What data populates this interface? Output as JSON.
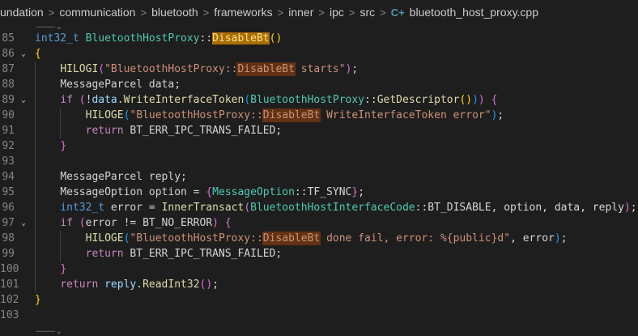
{
  "breadcrumb": {
    "items": [
      "undation",
      "communication",
      "bluetooth",
      "frameworks",
      "inner",
      "ipc",
      "src"
    ],
    "separator": ">",
    "file_icon": "C+",
    "file_name": "bluetooth_host_proxy.cpp"
  },
  "lines": [
    {
      "n": "85",
      "tokens": [
        {
          "t": "int32_t",
          "c": "kw"
        },
        {
          "t": " ",
          "c": "pl"
        },
        {
          "t": "BluetoothHostProxy",
          "c": "ty"
        },
        {
          "t": "::",
          "c": "pl"
        },
        {
          "t": "DisableBt",
          "c": "fn hl-sel"
        },
        {
          "t": "()",
          "c": "br1"
        }
      ]
    },
    {
      "n": "86",
      "fold": "v",
      "tokens": [
        {
          "t": "{",
          "c": "br1"
        }
      ]
    },
    {
      "n": "87",
      "guide": [
        1
      ],
      "tokens": [
        {
          "t": "    ",
          "c": "pl"
        },
        {
          "t": "HILOGI",
          "c": "fn"
        },
        {
          "t": "(",
          "c": "br2"
        },
        {
          "t": "\"BluetoothHostProxy::",
          "c": "str"
        },
        {
          "t": "DisableBt",
          "c": "str hl"
        },
        {
          "t": " starts\"",
          "c": "str"
        },
        {
          "t": ")",
          "c": "br2"
        },
        {
          "t": ";",
          "c": "pl"
        }
      ]
    },
    {
      "n": "88",
      "guide": [
        1
      ],
      "tokens": [
        {
          "t": "    ",
          "c": "pl"
        },
        {
          "t": "MessageParcel",
          "c": "pl"
        },
        {
          "t": " data;",
          "c": "pl"
        }
      ]
    },
    {
      "n": "89",
      "fold": "v",
      "guide": [
        1
      ],
      "tokens": [
        {
          "t": "    ",
          "c": "pl"
        },
        {
          "t": "if",
          "c": "kw2"
        },
        {
          "t": " ",
          "c": "pl"
        },
        {
          "t": "(",
          "c": "br2"
        },
        {
          "t": "!",
          "c": "pl"
        },
        {
          "t": "data",
          "c": "var"
        },
        {
          "t": ".",
          "c": "pl"
        },
        {
          "t": "WriteInterfaceToken",
          "c": "fn"
        },
        {
          "t": "(",
          "c": "br3"
        },
        {
          "t": "BluetoothHostProxy",
          "c": "ty"
        },
        {
          "t": "::",
          "c": "pl"
        },
        {
          "t": "GetDescriptor",
          "c": "fn"
        },
        {
          "t": "()",
          "c": "br1"
        },
        {
          "t": ")",
          "c": "br3"
        },
        {
          "t": ")",
          "c": "br2"
        },
        {
          "t": " ",
          "c": "pl"
        },
        {
          "t": "{",
          "c": "br2"
        }
      ]
    },
    {
      "n": "90",
      "guide": [
        1,
        2
      ],
      "tokens": [
        {
          "t": "        ",
          "c": "pl"
        },
        {
          "t": "HILOGE",
          "c": "fn"
        },
        {
          "t": "(",
          "c": "br3"
        },
        {
          "t": "\"BluetoothHostProxy::",
          "c": "str"
        },
        {
          "t": "DisableBt",
          "c": "str hl"
        },
        {
          "t": " WriteInterfaceToken error\"",
          "c": "str"
        },
        {
          "t": ")",
          "c": "br3"
        },
        {
          "t": ";",
          "c": "pl"
        }
      ]
    },
    {
      "n": "91",
      "guide": [
        1,
        2
      ],
      "tokens": [
        {
          "t": "        ",
          "c": "pl"
        },
        {
          "t": "return",
          "c": "kw2"
        },
        {
          "t": " BT_ERR_IPC_TRANS_FAILED;",
          "c": "pl"
        }
      ]
    },
    {
      "n": "92",
      "guide": [
        1
      ],
      "tokens": [
        {
          "t": "    ",
          "c": "pl"
        },
        {
          "t": "}",
          "c": "br2"
        }
      ]
    },
    {
      "n": "93",
      "guide": [
        1
      ],
      "tokens": []
    },
    {
      "n": "94",
      "guide": [
        1
      ],
      "tokens": [
        {
          "t": "    ",
          "c": "pl"
        },
        {
          "t": "MessageParcel",
          "c": "pl"
        },
        {
          "t": " reply;",
          "c": "pl"
        }
      ]
    },
    {
      "n": "95",
      "guide": [
        1
      ],
      "tokens": [
        {
          "t": "    ",
          "c": "pl"
        },
        {
          "t": "MessageOption",
          "c": "pl"
        },
        {
          "t": " option = ",
          "c": "pl"
        },
        {
          "t": "{",
          "c": "br2"
        },
        {
          "t": "MessageOption",
          "c": "ty"
        },
        {
          "t": "::",
          "c": "pl"
        },
        {
          "t": "TF_SYNC",
          "c": "pl"
        },
        {
          "t": "}",
          "c": "br2"
        },
        {
          "t": ";",
          "c": "pl"
        }
      ]
    },
    {
      "n": "96",
      "guide": [
        1
      ],
      "tokens": [
        {
          "t": "    ",
          "c": "pl"
        },
        {
          "t": "int32_t",
          "c": "kw"
        },
        {
          "t": " error = ",
          "c": "pl"
        },
        {
          "t": "InnerTransact",
          "c": "fn"
        },
        {
          "t": "(",
          "c": "br2"
        },
        {
          "t": "BluetoothHostInterfaceCode",
          "c": "ty"
        },
        {
          "t": "::",
          "c": "pl"
        },
        {
          "t": "BT_DISABLE, option, data, reply",
          "c": "pl"
        },
        {
          "t": ")",
          "c": "br2"
        },
        {
          "t": ";",
          "c": "pl"
        }
      ]
    },
    {
      "n": "97",
      "fold": "v",
      "guide": [
        1
      ],
      "tokens": [
        {
          "t": "    ",
          "c": "pl"
        },
        {
          "t": "if",
          "c": "kw2"
        },
        {
          "t": " ",
          "c": "pl"
        },
        {
          "t": "(",
          "c": "br2"
        },
        {
          "t": "error != BT_NO_ERROR",
          "c": "pl"
        },
        {
          "t": ")",
          "c": "br2"
        },
        {
          "t": " ",
          "c": "pl"
        },
        {
          "t": "{",
          "c": "br2"
        }
      ]
    },
    {
      "n": "98",
      "guide": [
        1,
        2
      ],
      "tokens": [
        {
          "t": "        ",
          "c": "pl"
        },
        {
          "t": "HILOGE",
          "c": "fn"
        },
        {
          "t": "(",
          "c": "br3"
        },
        {
          "t": "\"BluetoothHostProxy::",
          "c": "str"
        },
        {
          "t": "DisableBt",
          "c": "str hl"
        },
        {
          "t": " done fail, error: %{public}d\"",
          "c": "str"
        },
        {
          "t": ", error",
          "c": "pl"
        },
        {
          "t": ")",
          "c": "br3"
        },
        {
          "t": ";",
          "c": "pl"
        }
      ]
    },
    {
      "n": "99",
      "guide": [
        1,
        2
      ],
      "tokens": [
        {
          "t": "        ",
          "c": "pl"
        },
        {
          "t": "return",
          "c": "kw2"
        },
        {
          "t": " BT_ERR_IPC_TRANS_FAILED;",
          "c": "pl"
        }
      ]
    },
    {
      "n": "100",
      "guide": [
        1
      ],
      "tokens": [
        {
          "t": "    ",
          "c": "pl"
        },
        {
          "t": "}",
          "c": "br2"
        }
      ]
    },
    {
      "n": "101",
      "guide": [
        1
      ],
      "tokens": [
        {
          "t": "    ",
          "c": "pl"
        },
        {
          "t": "return",
          "c": "kw2"
        },
        {
          "t": " ",
          "c": "pl"
        },
        {
          "t": "reply",
          "c": "var"
        },
        {
          "t": ".",
          "c": "pl"
        },
        {
          "t": "ReadInt32",
          "c": "fn"
        },
        {
          "t": "()",
          "c": "br2"
        },
        {
          "t": ";",
          "c": "pl"
        }
      ]
    },
    {
      "n": "102",
      "tokens": [
        {
          "t": "}",
          "c": "br1"
        }
      ]
    },
    {
      "n": "103",
      "tokens": []
    }
  ],
  "colors": {
    "background": "#1e1e1e",
    "selection_highlight": "#a86e00",
    "word_highlight": "#613214"
  }
}
